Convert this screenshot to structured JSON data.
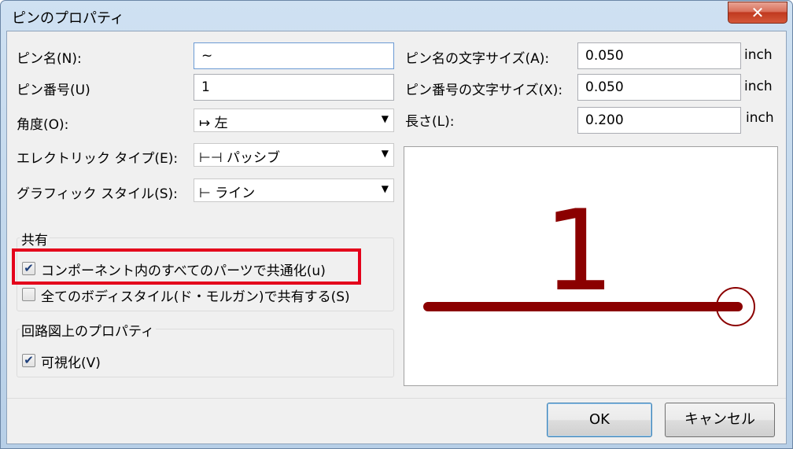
{
  "window": {
    "title": "ピンのプロパティ",
    "close_label": "✕"
  },
  "fields": {
    "pin_name": {
      "label": "ピン名(N):",
      "value": "~"
    },
    "pin_number": {
      "label": "ピン番号(U)",
      "value": "1"
    },
    "orientation": {
      "label": "角度(O):",
      "value": "↦ 左"
    },
    "electrical_type": {
      "label": "エレクトリック タイプ(E):",
      "value": "⊢⊣ パッシブ"
    },
    "graphic_style": {
      "label": "グラフィック スタイル(S):",
      "value": "⊢ ライン"
    },
    "name_text_size": {
      "label": "ピン名の文字サイズ(A):",
      "value": "0.050",
      "unit": "inch"
    },
    "number_text_size": {
      "label": "ピン番号の文字サイズ(X):",
      "value": "0.050",
      "unit": "inch"
    },
    "length": {
      "label": "長さ(L):",
      "value": "0.200",
      "unit": "inch"
    }
  },
  "shared_group": {
    "title": "共有",
    "common_to_units": {
      "label": "コンポーネント内のすべてのパーツで共通化(u)",
      "checked": true
    },
    "common_to_convert": {
      "label": "全てのボディスタイル(ド・モルガン)で共有する(S)",
      "checked": false
    }
  },
  "schematic_group": {
    "title": "回路図上のプロパティ",
    "visible": {
      "label": "可視化(V)",
      "checked": true
    }
  },
  "preview": {
    "pin_number_text": "1",
    "color": "#8b0000"
  },
  "buttons": {
    "ok": "OK",
    "cancel": "キャンセル"
  },
  "colors": {
    "highlight": "#e4001b",
    "pin": "#8b0000"
  }
}
